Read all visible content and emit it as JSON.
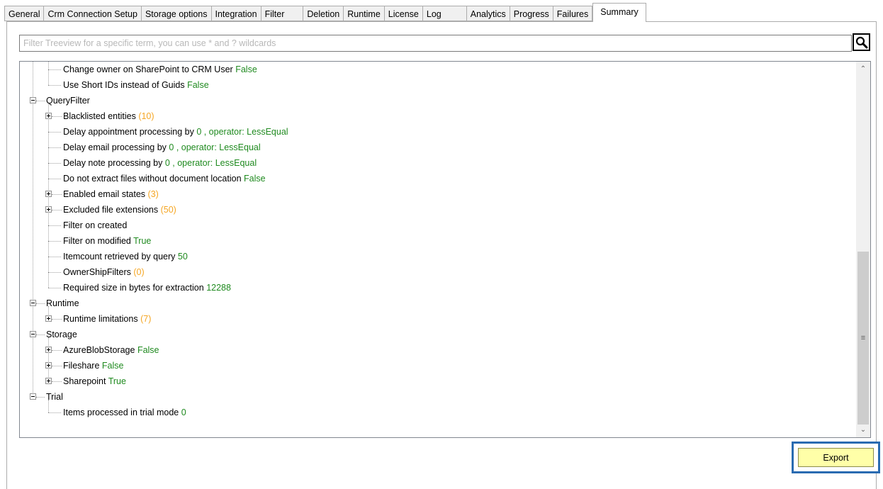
{
  "tabs": [
    {
      "label": "General"
    },
    {
      "label": "Crm Connection Setup"
    },
    {
      "label": "Storage options"
    },
    {
      "label": "Integration"
    },
    {
      "label": "Filter"
    },
    {
      "label": "Deletion"
    },
    {
      "label": "Runtime"
    },
    {
      "label": "License"
    },
    {
      "label": "Log"
    },
    {
      "label": "Analytics"
    },
    {
      "label": "Progress"
    },
    {
      "label": "Failures"
    },
    {
      "label": "Summary"
    }
  ],
  "active_tab": "Summary",
  "search": {
    "placeholder": "Filter Treeview for a specific term, you can use * and ? wildcards",
    "value": ""
  },
  "tree": {
    "rows": [
      {
        "label": "Change owner on SharePoint to CRM User",
        "value": "False",
        "value_color": "green"
      },
      {
        "label": "Use Short IDs instead of Guids",
        "value": "False",
        "value_color": "green"
      },
      {
        "label": "QueryFilter",
        "value": ""
      },
      {
        "label": "Blacklisted entities",
        "value": "(10)",
        "value_color": "orange"
      },
      {
        "label": "Delay appointment processing by",
        "value": "0 , operator: LessEqual",
        "value_color": "green"
      },
      {
        "label": "Delay email processing by",
        "value": "0 , operator: LessEqual",
        "value_color": "green"
      },
      {
        "label": "Delay note processing by",
        "value": "0 , operator: LessEqual",
        "value_color": "green"
      },
      {
        "label": "Do not extract files without document location",
        "value": "False",
        "value_color": "green"
      },
      {
        "label": "Enabled email states",
        "value": "(3)",
        "value_color": "orange"
      },
      {
        "label": "Excluded file extensions",
        "value": "(50)",
        "value_color": "orange"
      },
      {
        "label": "Filter on created",
        "value": ""
      },
      {
        "label": "Filter on modified",
        "value": "True",
        "value_color": "green"
      },
      {
        "label": "Itemcount retrieved by query",
        "value": "50",
        "value_color": "green"
      },
      {
        "label": "OwnerShipFilters",
        "value": "(0)",
        "value_color": "orange"
      },
      {
        "label": "Required size in bytes for extraction",
        "value": "12288",
        "value_color": "green"
      },
      {
        "label": "Runtime",
        "value": ""
      },
      {
        "label": "Runtime limitations",
        "value": "(7)",
        "value_color": "orange"
      },
      {
        "label": "Storage",
        "value": ""
      },
      {
        "label": "AzureBlobStorage",
        "value": "False",
        "value_color": "green"
      },
      {
        "label": "Fileshare",
        "value": "False",
        "value_color": "green"
      },
      {
        "label": "Sharepoint",
        "value": "True",
        "value_color": "green"
      },
      {
        "label": "Trial",
        "value": ""
      },
      {
        "label": "Items processed in trial mode",
        "value": "0",
        "value_color": "green"
      }
    ]
  },
  "export_label": "Export",
  "colors": {
    "green": "#1f8a1f",
    "orange": "#f5a623",
    "highlight_border": "#2a6bb1",
    "button_bg": "#ffffa8"
  }
}
